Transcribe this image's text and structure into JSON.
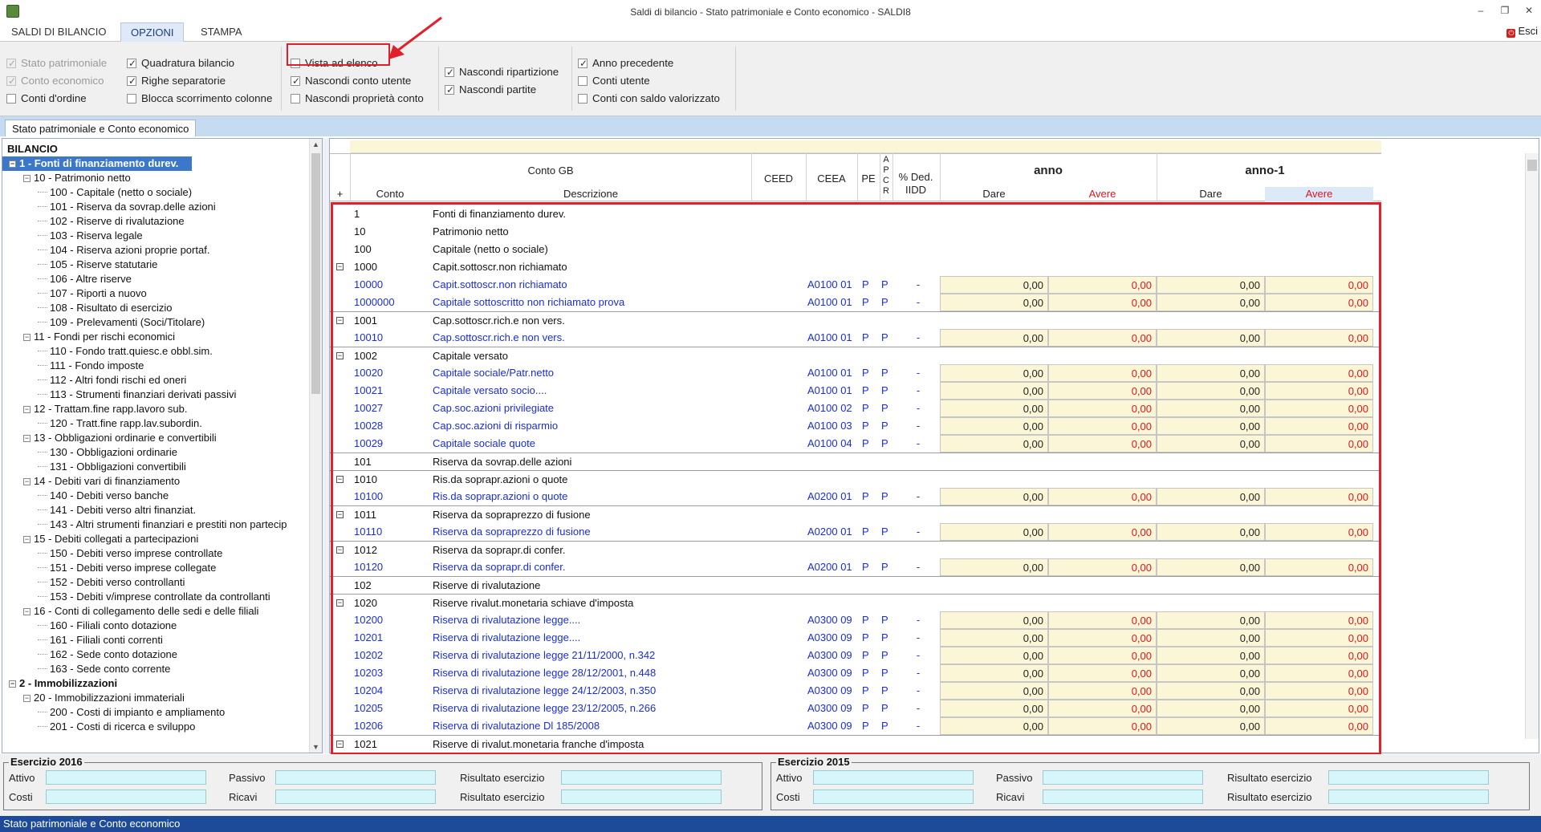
{
  "window": {
    "title": "Saldi di bilancio - Stato patrimoniale e Conto economico - SALDI8"
  },
  "menu": {
    "tabs": [
      "SALDI DI BILANCIO",
      "OPZIONI",
      "STAMPA"
    ],
    "active": "OPZIONI",
    "exit_label": "Esci"
  },
  "options": {
    "col1": [
      {
        "label": "Stato patrimoniale",
        "checked": true,
        "disabled": true
      },
      {
        "label": "Conto economico",
        "checked": true,
        "disabled": true
      },
      {
        "label": "Conti d'ordine",
        "checked": false,
        "disabled": false
      }
    ],
    "col2": [
      {
        "label": "Quadratura bilancio",
        "checked": true
      },
      {
        "label": "Righe separatorie",
        "checked": true
      },
      {
        "label": "Blocca scorrimento colonne",
        "checked": false
      }
    ],
    "col3": [
      {
        "label": "Vista ad elenco",
        "checked": false
      },
      {
        "label": "Nascondi conto utente",
        "checked": true
      },
      {
        "label": "Nascondi proprietà conto",
        "checked": false
      }
    ],
    "col4": [
      {
        "label": "Nascondi ripartizione",
        "checked": true
      },
      {
        "label": "Nascondi partite",
        "checked": true
      }
    ],
    "col5": [
      {
        "label": "Anno precedente",
        "checked": true
      },
      {
        "label": "Conti utente",
        "checked": false
      },
      {
        "label": "Conti con saldo valorizzato",
        "checked": false
      }
    ]
  },
  "doc_tab": "Stato patrimoniale e Conto economico",
  "tree": {
    "root": "BILANCIO",
    "nodes": [
      {
        "label": "1 - Fonti di finanziamento durev.",
        "level": 0,
        "exp": "−",
        "selected": true
      },
      {
        "label": "10 - Patrimonio netto",
        "level": 1,
        "exp": "−"
      },
      {
        "label": "100 - Capitale (netto o sociale)",
        "level": 2
      },
      {
        "label": "101 - Riserva da sovrap.delle azioni",
        "level": 2
      },
      {
        "label": "102 - Riserve di rivalutazione",
        "level": 2
      },
      {
        "label": "103 - Riserva legale",
        "level": 2
      },
      {
        "label": "104 - Riserva azioni proprie portaf.",
        "level": 2
      },
      {
        "label": "105 - Riserve statutarie",
        "level": 2
      },
      {
        "label": "106 - Altre riserve",
        "level": 2
      },
      {
        "label": "107 - Riporti a nuovo",
        "level": 2
      },
      {
        "label": "108 - Risultato di esercizio",
        "level": 2
      },
      {
        "label": "109 - Prelevamenti (Soci/Titolare)",
        "level": 2
      },
      {
        "label": "11 - Fondi per rischi economici",
        "level": 1,
        "exp": "−"
      },
      {
        "label": "110 - Fondo tratt.quiesc.e obbl.sim.",
        "level": 2
      },
      {
        "label": "111 - Fondo imposte",
        "level": 2
      },
      {
        "label": "112 - Altri fondi rischi ed oneri",
        "level": 2
      },
      {
        "label": "113 - Strumenti finanziari derivati passivi",
        "level": 2
      },
      {
        "label": "12 - Trattam.fine rapp.lavoro sub.",
        "level": 1,
        "exp": "−"
      },
      {
        "label": "120 - Tratt.fine rapp.lav.subordin.",
        "level": 2
      },
      {
        "label": "13 - Obbligazioni ordinarie e convertibili",
        "level": 1,
        "exp": "−"
      },
      {
        "label": "130 - Obbligazioni ordinarie",
        "level": 2
      },
      {
        "label": "131 - Obbligazioni convertibili",
        "level": 2
      },
      {
        "label": "14 - Debiti vari di finanziamento",
        "level": 1,
        "exp": "−"
      },
      {
        "label": "140 - Debiti verso banche",
        "level": 2
      },
      {
        "label": "141 - Debiti verso altri finanziat.",
        "level": 2
      },
      {
        "label": "143 - Altri strumenti finanziari e prestiti non partecip",
        "level": 2
      },
      {
        "label": "15 - Debiti collegati a partecipazioni",
        "level": 1,
        "exp": "−"
      },
      {
        "label": "150 - Debiti verso imprese controllate",
        "level": 2
      },
      {
        "label": "151 - Debiti verso imprese collegate",
        "level": 2
      },
      {
        "label": "152 - Debiti verso controllanti",
        "level": 2
      },
      {
        "label": "153 - Debiti v/imprese controllate da controllanti",
        "level": 2
      },
      {
        "label": "16 - Conti di collegamento delle sedi e delle filiali",
        "level": 1,
        "exp": "−"
      },
      {
        "label": "160 - Filiali conto dotazione",
        "level": 2
      },
      {
        "label": "161 - Filiali conti correnti",
        "level": 2
      },
      {
        "label": "162 - Sede conto dotazione",
        "level": 2
      },
      {
        "label": "163 - Sede conto corrente",
        "level": 2
      },
      {
        "label": "2 - Immobilizzazioni",
        "level": 0,
        "exp": "−",
        "bold": true
      },
      {
        "label": "20 - Immobilizzazioni immateriali",
        "level": 1,
        "exp": "−"
      },
      {
        "label": "200 - Costi di impianto e ampliamento",
        "level": 2
      },
      {
        "label": "201 - Costi di ricerca e sviluppo",
        "level": 2
      }
    ]
  },
  "grid": {
    "headers": {
      "conto_gb": "Conto GB",
      "plus": "+",
      "conto": "Conto",
      "descrizione": "Descrizione",
      "ceed": "CEED",
      "ceea": "CEEA",
      "pe": "PE",
      "apcr": [
        "A",
        "P",
        "C",
        "R"
      ],
      "ded": "% Ded.",
      "iidd": "IIDD",
      "anno": "anno",
      "anno1": "anno-1",
      "dare": "Dare",
      "avere": "Avere"
    },
    "rows": [
      {
        "code": "1",
        "desc": "Fonti di finanziamento durev.",
        "type": "group"
      },
      {
        "code": "10",
        "desc": "Patrimonio netto",
        "type": "group"
      },
      {
        "code": "100",
        "desc": "Capitale (netto o sociale)",
        "type": "group"
      },
      {
        "code": "1000",
        "desc": "Capit.sottoscr.non richiamato",
        "type": "sub"
      },
      {
        "code": "10000",
        "desc": "Capit.sottoscr.non richiamato",
        "type": "leaf",
        "ceea": "A0100 01",
        "pe": "P",
        "apcr": "P",
        "ded": "-",
        "vals": [
          "0,00",
          "0,00",
          "0,00",
          "0,00"
        ]
      },
      {
        "code": "1000000",
        "desc": "Capitale sottoscritto non richiamato prova",
        "type": "leaf",
        "ceea": "A0100 01",
        "pe": "P",
        "apcr": "P",
        "ded": "-",
        "vals": [
          "0,00",
          "0,00",
          "0,00",
          "0,00"
        ]
      },
      {
        "code": "1001",
        "desc": "Cap.sottoscr.rich.e non vers.",
        "type": "sub"
      },
      {
        "code": "10010",
        "desc": "Cap.sottoscr.rich.e non vers.",
        "type": "leaf",
        "ceea": "A0100 01",
        "pe": "P",
        "apcr": "P",
        "ded": "-",
        "vals": [
          "0,00",
          "0,00",
          "0,00",
          "0,00"
        ]
      },
      {
        "code": "1002",
        "desc": "Capitale versato",
        "type": "sub"
      },
      {
        "code": "10020",
        "desc": "Capitale sociale/Patr.netto",
        "type": "leaf",
        "ceea": "A0100 01",
        "pe": "P",
        "apcr": "P",
        "ded": "-",
        "vals": [
          "0,00",
          "0,00",
          "0,00",
          "0,00"
        ]
      },
      {
        "code": "10021",
        "desc": "Capitale versato socio....",
        "type": "leaf",
        "ceea": "A0100 01",
        "pe": "P",
        "apcr": "P",
        "ded": "-",
        "vals": [
          "0,00",
          "0,00",
          "0,00",
          "0,00"
        ]
      },
      {
        "code": "10027",
        "desc": "Cap.soc.azioni privilegiate",
        "type": "leaf",
        "ceea": "A0100 02",
        "pe": "P",
        "apcr": "P",
        "ded": "-",
        "vals": [
          "0,00",
          "0,00",
          "0,00",
          "0,00"
        ]
      },
      {
        "code": "10028",
        "desc": "Cap.soc.azioni di risparmio",
        "type": "leaf",
        "ceea": "A0100 03",
        "pe": "P",
        "apcr": "P",
        "ded": "-",
        "vals": [
          "0,00",
          "0,00",
          "0,00",
          "0,00"
        ]
      },
      {
        "code": "10029",
        "desc": "Capitale sociale quote",
        "type": "leaf",
        "ceea": "A0100 04",
        "pe": "P",
        "apcr": "P",
        "ded": "-",
        "vals": [
          "0,00",
          "0,00",
          "0,00",
          "0,00"
        ]
      },
      {
        "code": "101",
        "desc": "Riserva da sovrap.delle azioni",
        "type": "group",
        "sep": true
      },
      {
        "code": "1010",
        "desc": "Ris.da soprapr.azioni o quote",
        "type": "sub"
      },
      {
        "code": "10100",
        "desc": "Ris.da soprapr.azioni o quote",
        "type": "leaf",
        "ceea": "A0200 01",
        "pe": "P",
        "apcr": "P",
        "ded": "-",
        "vals": [
          "0,00",
          "0,00",
          "0,00",
          "0,00"
        ]
      },
      {
        "code": "1011",
        "desc": "Riserva da sopraprezzo di fusione",
        "type": "sub"
      },
      {
        "code": "10110",
        "desc": "Riserva da sopraprezzo di fusione",
        "type": "leaf",
        "ceea": "A0200 01",
        "pe": "P",
        "apcr": "P",
        "ded": "-",
        "vals": [
          "0,00",
          "0,00",
          "0,00",
          "0,00"
        ]
      },
      {
        "code": "1012",
        "desc": "Riserva da soprapr.di confer.",
        "type": "sub"
      },
      {
        "code": "10120",
        "desc": "Riserva da soprapr.di confer.",
        "type": "leaf",
        "ceea": "A0200 01",
        "pe": "P",
        "apcr": "P",
        "ded": "-",
        "vals": [
          "0,00",
          "0,00",
          "0,00",
          "0,00"
        ]
      },
      {
        "code": "102",
        "desc": "Riserve di rivalutazione",
        "type": "group",
        "sep": true
      },
      {
        "code": "1020",
        "desc": "Riserve rivalut.monetaria schiave d'imposta",
        "type": "sub",
        "noexp": true
      },
      {
        "code": "10200",
        "desc": "Riserva di rivalutazione legge....",
        "type": "leaf",
        "ceea": "A0300 09",
        "pe": "P",
        "apcr": "P",
        "ded": "-",
        "vals": [
          "0,00",
          "0,00",
          "0,00",
          "0,00"
        ]
      },
      {
        "code": "10201",
        "desc": "Riserva di rivalutazione legge....",
        "type": "leaf",
        "ceea": "A0300 09",
        "pe": "P",
        "apcr": "P",
        "ded": "-",
        "vals": [
          "0,00",
          "0,00",
          "0,00",
          "0,00"
        ]
      },
      {
        "code": "10202",
        "desc": "Riserva di rivalutazione legge 21/11/2000, n.342",
        "type": "leaf",
        "ceea": "A0300 09",
        "pe": "P",
        "apcr": "P",
        "ded": "-",
        "vals": [
          "0,00",
          "0,00",
          "0,00",
          "0,00"
        ]
      },
      {
        "code": "10203",
        "desc": "Riserva di rivalutazione legge 28/12/2001, n.448",
        "type": "leaf",
        "ceea": "A0300 09",
        "pe": "P",
        "apcr": "P",
        "ded": "-",
        "vals": [
          "0,00",
          "0,00",
          "0,00",
          "0,00"
        ]
      },
      {
        "code": "10204",
        "desc": "Riserva di rivalutazione legge 24/12/2003, n.350",
        "type": "leaf",
        "ceea": "A0300 09",
        "pe": "P",
        "apcr": "P",
        "ded": "-",
        "vals": [
          "0,00",
          "0,00",
          "0,00",
          "0,00"
        ]
      },
      {
        "code": "10205",
        "desc": "Riserva di rivalutazione legge 23/12/2005, n.266",
        "type": "leaf",
        "ceea": "A0300 09",
        "pe": "P",
        "apcr": "P",
        "ded": "-",
        "vals": [
          "0,00",
          "0,00",
          "0,00",
          "0,00"
        ]
      },
      {
        "code": "10206",
        "desc": "Riserva di rivalutazione Dl 185/2008",
        "type": "leaf",
        "ceea": "A0300 09",
        "pe": "P",
        "apcr": "P",
        "ded": "-",
        "vals": [
          "0,00",
          "0,00",
          "0,00",
          "0,00"
        ]
      },
      {
        "code": "1021",
        "desc": "Riserve di rivalut.monetaria franche d'imposta",
        "type": "sub"
      }
    ]
  },
  "footer": {
    "ex1": {
      "title": "Esercizio 2016",
      "attivo": "Attivo",
      "passivo": "Passivo",
      "risultato1": "Risultato esercizio",
      "costi": "Costi",
      "ricavi": "Ricavi",
      "risultato2": "Risultato esercizio"
    },
    "ex2": {
      "title": "Esercizio 2015",
      "attivo": "Attivo",
      "passivo": "Passivo",
      "risultato1": "Risultato esercizio",
      "costi": "Costi",
      "ricavi": "Ricavi",
      "risultato2": "Risultato esercizio"
    }
  },
  "status": "Stato patrimoniale e Conto economico",
  "colors": {
    "blue_text": "#1a2ed4",
    "red_text": "#e0141e",
    "highlight": "#e0202a",
    "cell_yellow": "#fbf7d6",
    "status_bg": "#1e4a9a"
  }
}
